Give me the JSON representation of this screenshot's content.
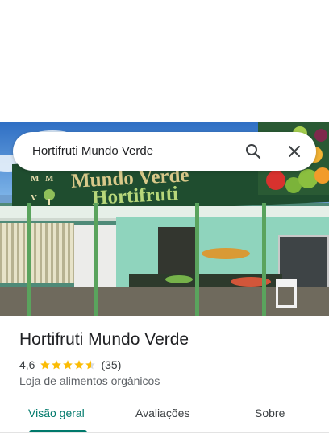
{
  "search": {
    "query": "Hortifruti Mundo Verde"
  },
  "photo": {
    "sign_line1": "Mundo Verde",
    "sign_line2": "Hortifruti",
    "sign_badge_letters": [
      "M",
      "M",
      "V"
    ]
  },
  "place": {
    "name": "Hortifruti Mundo Verde",
    "rating": "4,6",
    "rating_stars": 4.6,
    "review_count": "(35)",
    "category": "Loja de alimentos orgânicos"
  },
  "tabs": [
    {
      "label": "Visão geral",
      "active": true
    },
    {
      "label": "Avaliações",
      "active": false
    },
    {
      "label": "Sobre",
      "active": false
    }
  ],
  "colors": {
    "accent": "#00796b",
    "star": "#fbbc04",
    "text_primary": "#202124",
    "text_secondary": "#5f6368"
  },
  "icons": {
    "search": "search-icon",
    "close": "close-icon"
  }
}
